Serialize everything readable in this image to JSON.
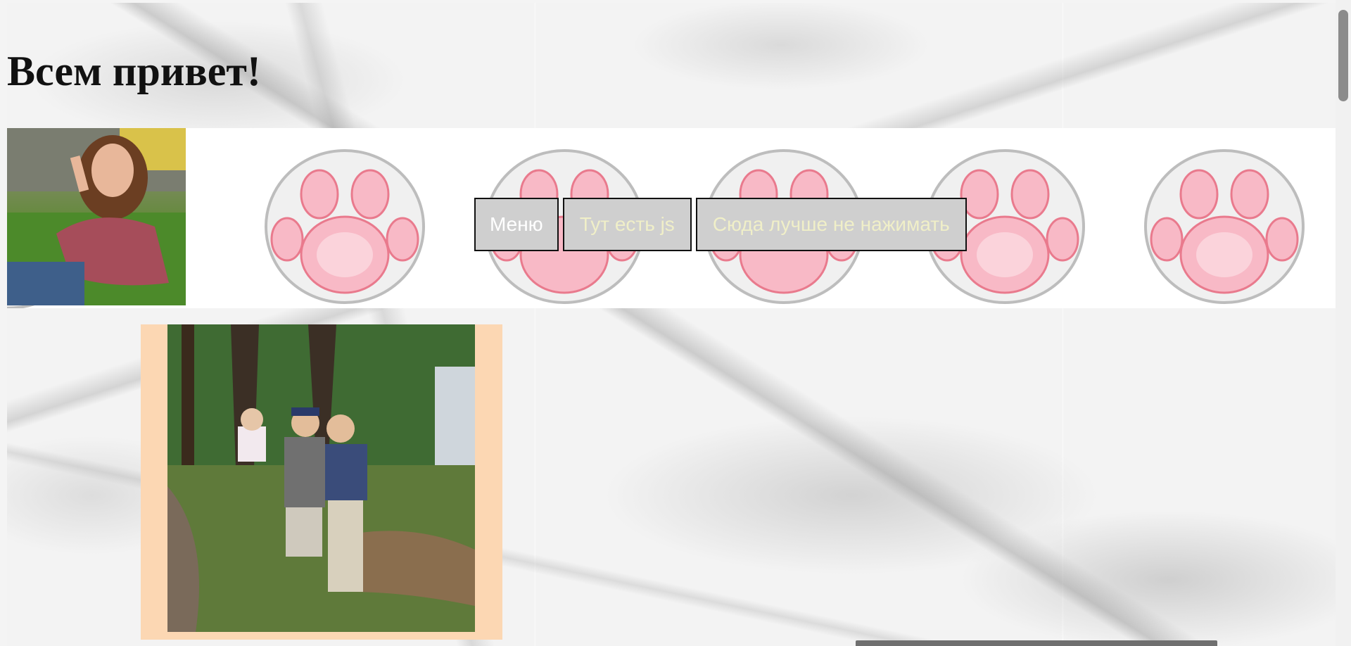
{
  "page": {
    "heading": "Всем привет!"
  },
  "banner": {
    "paw_icon": "paw-print-icon",
    "avatar_alt": "girl-showing-peace-sign-photo"
  },
  "nav": {
    "menu_label": "Меню",
    "js_label": "Тут есть js",
    "dont_click_label": "Сюда лучше не нажимать"
  },
  "gallery": {
    "photo_alt": "three-children-outdoors-photo",
    "frame_color": "#fcd7b3"
  },
  "colors": {
    "button_bg": "#cfcfcf",
    "menu_text": "#ffffff",
    "js_text": "#f0efc8",
    "paw_pad": "#f8b9c6"
  }
}
